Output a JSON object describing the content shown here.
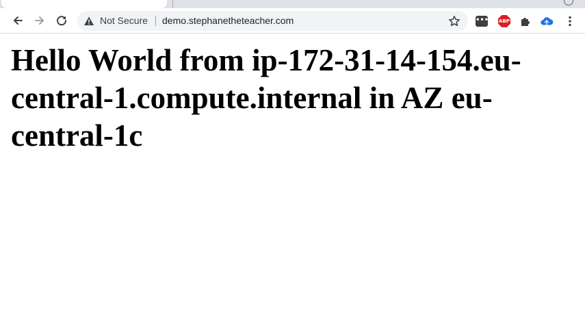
{
  "browser": {
    "security_label": "Not Secure",
    "url": "demo.stephanetheteacher.com",
    "extensions": {
      "dots_label": "•••",
      "abp_label": "ABP"
    }
  },
  "icons": {
    "back": "back-arrow-icon",
    "forward": "forward-arrow-icon",
    "reload": "reload-icon",
    "warning": "warning-triangle-icon",
    "bookmark": "star-icon",
    "extensions": "puzzle-icon",
    "cloud": "cloud-icon",
    "menu": "kebab-menu-icon"
  },
  "page": {
    "heading": "Hello World from ip-172-31-14-154.eu-central-1.compute.internal in AZ eu-central-1c"
  },
  "colors": {
    "toolbar_bg": "#ffffff",
    "omnibox_bg": "#f1f3f4",
    "tabstrip_bg": "#dee1e6",
    "abp_red": "#d81f26",
    "cloud_blue": "#1a73e8"
  }
}
